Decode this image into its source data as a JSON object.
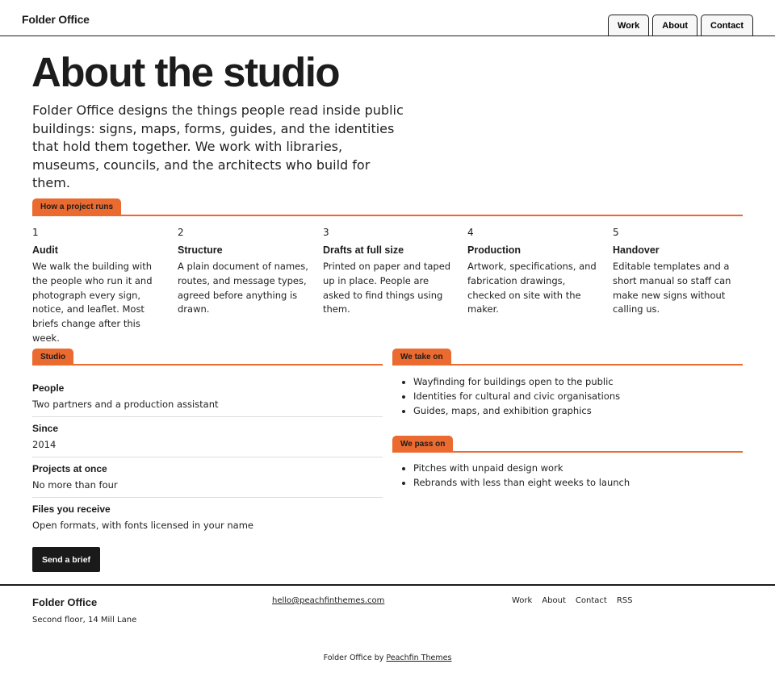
{
  "header": {
    "logo": "Folder Office",
    "nav": [
      "Work",
      "About",
      "Contact"
    ]
  },
  "hero": {
    "title": "About the studio",
    "intro": "Folder Office designs the things people read inside public buildings: signs, maps, forms, guides, and the identities that hold them together. We work with libraries, museums, councils, and the architects who build for them."
  },
  "process": {
    "tab": "How a project runs",
    "steps": [
      {
        "num": "1",
        "title": "Audit",
        "body": "We walk the building with the people who run it and photograph every sign, notice, and leaflet. Most briefs change after this week."
      },
      {
        "num": "2",
        "title": "Structure",
        "body": "A plain document of names, routes, and message types, agreed before anything is drawn."
      },
      {
        "num": "3",
        "title": "Drafts at full size",
        "body": "Printed on paper and taped up in place. People are asked to find things using them."
      },
      {
        "num": "4",
        "title": "Production",
        "body": "Artwork, specifications, and fabrication drawings, checked on site with the maker."
      },
      {
        "num": "5",
        "title": "Handover",
        "body": "Editable templates and a short manual so staff can make new signs without calling us."
      }
    ]
  },
  "studio": {
    "tab": "Studio",
    "facts": [
      {
        "label": "People",
        "value": "Two partners and a production assistant"
      },
      {
        "label": "Since",
        "value": "2014"
      },
      {
        "label": "Projects at once",
        "value": "No more than four"
      },
      {
        "label": "Files you receive",
        "value": "Open formats, with fonts licensed in your name"
      }
    ],
    "button": "Send a brief"
  },
  "take_on": {
    "tab": "We take on",
    "items": [
      "Wayfinding for buildings open to the public",
      "Identities for cultural and civic organisations",
      "Guides, maps, and exhibition graphics"
    ]
  },
  "pass_on": {
    "tab": "We pass on",
    "items": [
      "Pitches with unpaid design work",
      "Rebrands with less than eight weeks to launch"
    ]
  },
  "footer": {
    "logo": "Folder Office",
    "address": "Second floor, 14 Mill Lane",
    "email": "hello@peachfinthemes.com",
    "links": [
      "Work",
      "About",
      "Contact",
      "RSS"
    ],
    "credit_prefix": "Folder Office by",
    "credit_link": "Peachfin Themes"
  },
  "colors": {
    "accent": "#ea6a2f",
    "text": "#1c1c1c",
    "button": "#1a1a1a"
  }
}
